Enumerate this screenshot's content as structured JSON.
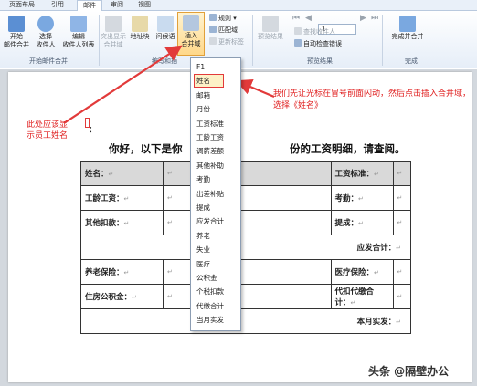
{
  "ribbon": {
    "tabs": [
      "页面布局",
      "引用",
      "邮件",
      "审阅",
      "视图"
    ],
    "active_tab": "邮件",
    "buttons": {
      "start_merge": "开始\n邮件合并",
      "select_recipients": "选择\n收件人",
      "edit_recipients": "编辑\n收件人列表",
      "highlight_fields": "突出显示\n合并域",
      "address_block": "地址块",
      "greeting_line": "问候语",
      "insert_merge_field": "插入\n合并域",
      "rules": "规则",
      "match_fields": "匹配域",
      "update_labels": "更新标签",
      "preview_results": "预览结果",
      "find_recipient": "查找收件人",
      "auto_check": "自动检查错误",
      "finish_merge": "完成并合并"
    },
    "nav_value": "1",
    "groups": {
      "start": "开始邮件合并",
      "write": "编写和插",
      "preview": "预览结果",
      "finish": "完成"
    }
  },
  "dropdown": {
    "items": [
      "F1",
      "姓名",
      "邮箱",
      "月份",
      "工资标准",
      "工龄工资",
      "调薪差额",
      "其他补助",
      "考勤",
      "出差补贴",
      "提成",
      "应发合计",
      "养老",
      "失业",
      "医疗",
      "公积金",
      "个税扣款",
      "代缴合计",
      "当月实发"
    ],
    "selected": "姓名"
  },
  "document": {
    "colon": "：",
    "greeting_left": "你好，以下是你",
    "greeting_right": "份的工资明细，请查阅。",
    "table": [
      [
        {
          "t": "姓名："
        },
        {
          "t": "",
          "w": 2
        },
        {
          "t": "工资标准："
        },
        {
          "t": ""
        }
      ],
      [
        {
          "t": "工龄工资："
        },
        {
          "t": "",
          "w": 2
        },
        {
          "t": "考勤："
        },
        {
          "t": ""
        }
      ],
      [
        {
          "t": "其他扣款："
        },
        {
          "t": "",
          "w": 2
        },
        {
          "t": "提成："
        },
        {
          "t": ""
        }
      ],
      [
        {
          "t": "应发合计：",
          "full": true
        }
      ],
      [
        {
          "t": "养老保险："
        },
        {
          "t": "",
          "w": 2
        },
        {
          "t": "医疗保险："
        },
        {
          "t": ""
        }
      ],
      [
        {
          "t": "住房公积金："
        },
        {
          "t": "",
          "w": 2
        },
        {
          "t": "代扣代缴合计："
        },
        {
          "t": ""
        }
      ],
      [
        {
          "t": "本月实发：",
          "full": true
        }
      ]
    ],
    "return_mark": "↵"
  },
  "annotations": {
    "left_note": "此处应该显示员工姓名",
    "right_note": "我们先让光标在冒号前面闪动，然后点击插入合并域，选择《姓名》"
  },
  "watermark": "头条 @隔壁办公",
  "colors": {
    "accent_red": "#e23a3a",
    "ribbon_bg": "#e6eef8",
    "table_shade": "#d9d9d9"
  }
}
